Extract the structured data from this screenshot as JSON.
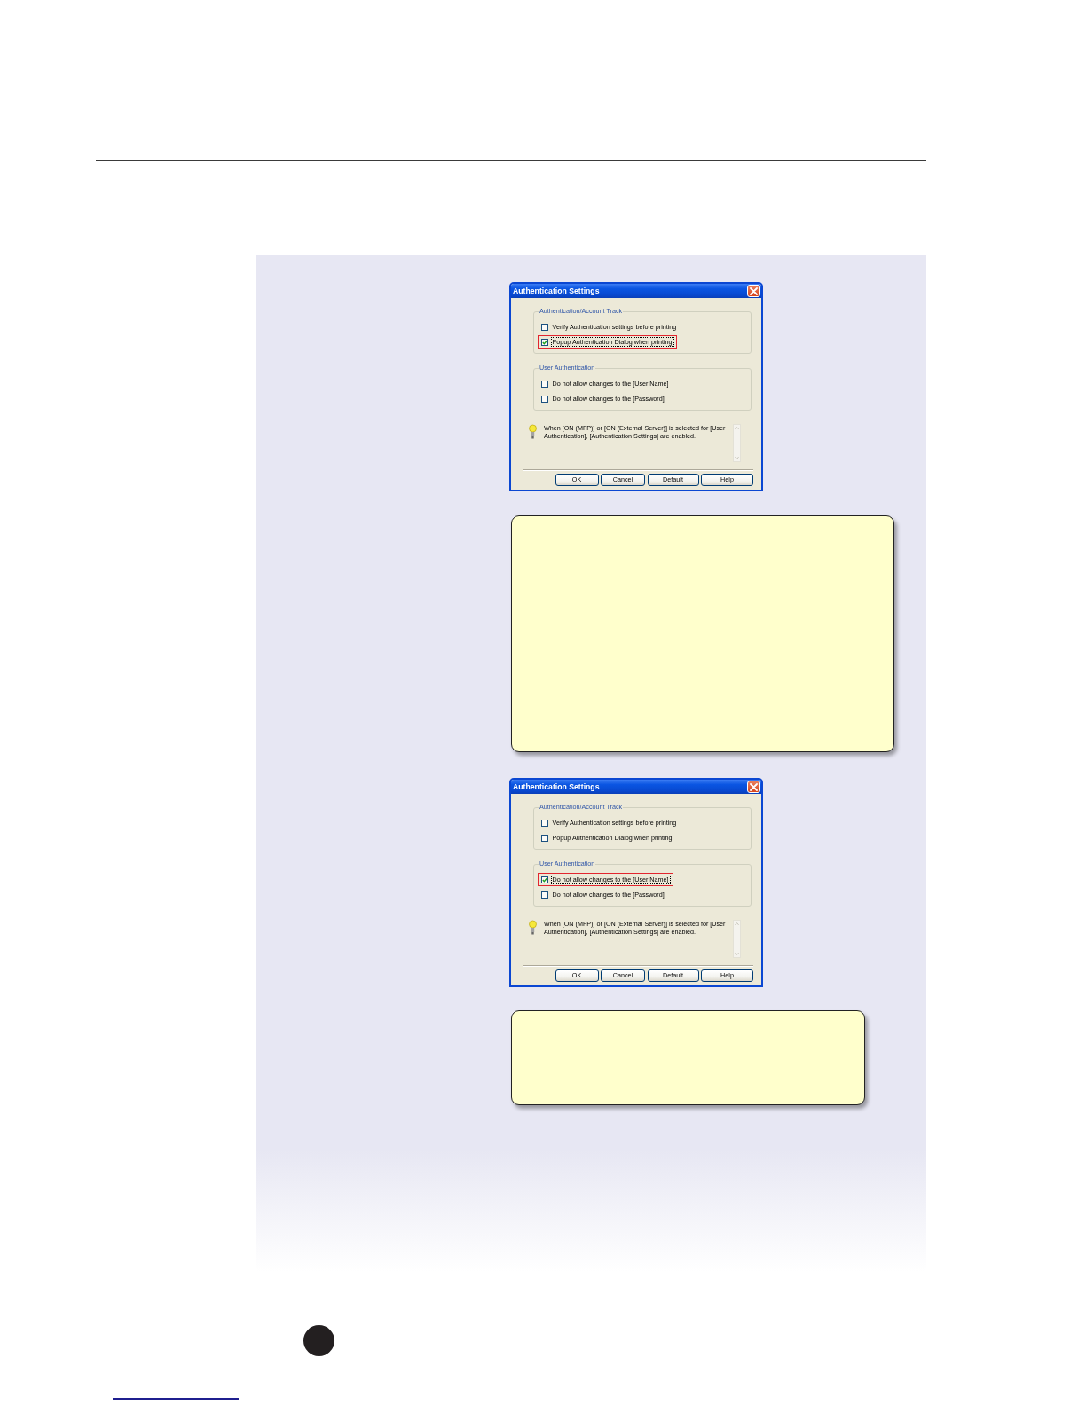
{
  "content": [
    {
      "kind": "dialog",
      "title": "Authentication Settings",
      "groups": [
        {
          "label": "Authentication/Account Track",
          "options": [
            {
              "label": "Verify Authentication settings before printing",
              "checked": false,
              "focused": false,
              "highlighted": false
            },
            {
              "label": "Popup Authentication Dialog when printing",
              "checked": true,
              "focused": true,
              "highlighted": true
            }
          ]
        },
        {
          "label": "User Authentication",
          "options": [
            {
              "label": "Do not allow changes to the [User Name]",
              "checked": false,
              "focused": false,
              "highlighted": false
            },
            {
              "label": "Do not allow changes to the [Password]",
              "checked": false,
              "focused": false,
              "highlighted": false
            }
          ]
        }
      ],
      "info": "When [ON (MFP)] or [ON (External Server)] is selected for [User Authentication], [Authentication Settings] are enabled.",
      "buttons": [
        "OK",
        "Cancel",
        "Default",
        "Help"
      ]
    },
    {
      "kind": "note"
    },
    {
      "kind": "dialog",
      "title": "Authentication Settings",
      "groups": [
        {
          "label": "Authentication/Account Track",
          "options": [
            {
              "label": "Verify Authentication settings before printing",
              "checked": false,
              "focused": false,
              "highlighted": false
            },
            {
              "label": "Popup Authentication Dialog when printing",
              "checked": false,
              "focused": false,
              "highlighted": false
            }
          ]
        },
        {
          "label": "User Authentication",
          "options": [
            {
              "label": "Do not allow changes to the [User Name]",
              "checked": true,
              "focused": true,
              "highlighted": true
            },
            {
              "label": "Do not allow changes to the [Password]",
              "checked": false,
              "focused": false,
              "highlighted": false
            }
          ]
        }
      ],
      "info": "When [ON (MFP)] or [ON (External Server)] is selected for [User Authentication], [Authentication Settings] are enabled.",
      "buttons": [
        "OK",
        "Cancel",
        "Default",
        "Help"
      ]
    },
    {
      "kind": "note"
    }
  ]
}
